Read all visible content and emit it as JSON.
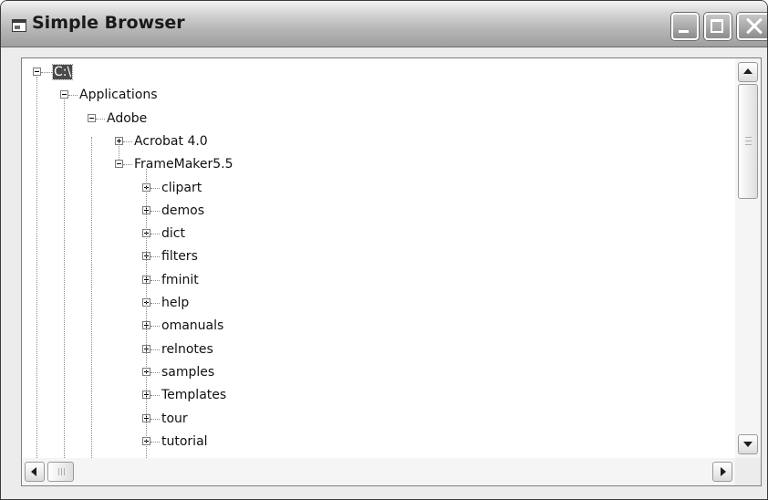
{
  "window": {
    "title": "Simple Browser"
  },
  "tree": {
    "root": {
      "label": "C:\\",
      "expanded": true,
      "selected": true
    },
    "items": [
      {
        "label": "Applications",
        "level": 1,
        "expander": "minus"
      },
      {
        "label": "Adobe",
        "level": 2,
        "expander": "minus"
      },
      {
        "label": "Acrobat 4.0",
        "level": 3,
        "expander": "plus"
      },
      {
        "label": "FrameMaker5.5",
        "level": 3,
        "expander": "minus"
      },
      {
        "label": "clipart",
        "level": 4,
        "expander": "plus"
      },
      {
        "label": "demos",
        "level": 4,
        "expander": "plus"
      },
      {
        "label": "dict",
        "level": 4,
        "expander": "plus"
      },
      {
        "label": "filters",
        "level": 4,
        "expander": "plus"
      },
      {
        "label": "fminit",
        "level": 4,
        "expander": "plus"
      },
      {
        "label": "help",
        "level": 4,
        "expander": "plus"
      },
      {
        "label": "omanuals",
        "level": 4,
        "expander": "plus"
      },
      {
        "label": "relnotes",
        "level": 4,
        "expander": "plus"
      },
      {
        "label": "samples",
        "level": 4,
        "expander": "plus"
      },
      {
        "label": "Templates",
        "level": 4,
        "expander": "plus"
      },
      {
        "label": "tour",
        "level": 4,
        "expander": "plus"
      },
      {
        "label": "tutorial",
        "level": 4,
        "expander": "plus"
      }
    ]
  },
  "scrollbars": {
    "vertical_thumb_fraction": 0.33,
    "vertical_position_fraction": 0.0,
    "horizontal_thumb_fraction": 0.04,
    "horizontal_position_fraction": 0.0
  }
}
